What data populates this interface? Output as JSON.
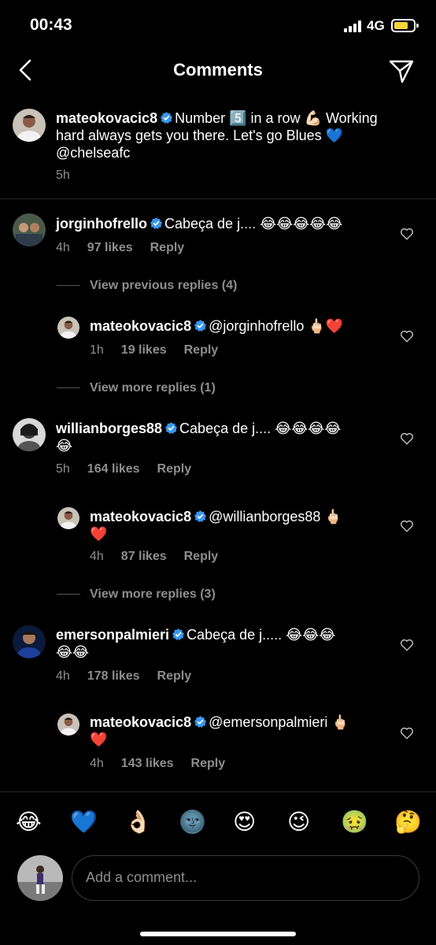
{
  "status_bar": {
    "time": "00:43",
    "network": "4G"
  },
  "header": {
    "title": "Comments"
  },
  "caption": {
    "username": "mateokovacic8",
    "text_line1": "Number 5️⃣ in a row 💪🏻 Working",
    "text_line2": "hard always gets you there. Let's go Blues 💙",
    "text_line3": "@chelseafc",
    "time": "5h"
  },
  "comments": [
    {
      "username": "jorginhofrello",
      "text": "Cabeça de j.... 😂😂😂😂😂",
      "time": "4h",
      "likes": "97 likes",
      "reply": "Reply",
      "view_previous": "View previous replies (4)",
      "reply_item": {
        "username": "mateokovacic8",
        "text": "@jorginhofrello 🖕🏻❤️",
        "time": "1h",
        "likes": "19 likes",
        "reply": "Reply"
      },
      "view_more": "View more replies (1)"
    },
    {
      "username": "willianborges88",
      "text_line1": "Cabeça de j.... 😂😂😂😂",
      "text_line2": "😂",
      "time": "5h",
      "likes": "164 likes",
      "reply": "Reply",
      "reply_item": {
        "username": "mateokovacic8",
        "text_line1": "@willianborges88 🖕🏻",
        "text_line2": "❤️",
        "time": "4h",
        "likes": "87 likes",
        "reply": "Reply"
      },
      "view_more": "View more replies (3)"
    },
    {
      "username": "emersonpalmieri",
      "text_line1": "Cabeça de j..... 😂😂😂",
      "text_line2": "😂😂",
      "time": "4h",
      "likes": "178 likes",
      "reply": "Reply",
      "reply_item": {
        "username": "mateokovacic8",
        "text_line1": "@emersonpalmieri 🖕🏻",
        "text_line2": "❤️",
        "time": "4h",
        "likes": "143 likes",
        "reply": "Reply"
      }
    }
  ],
  "emoji_bar": [
    "😂",
    "💙",
    "👌🏻",
    "🌚",
    "😍",
    "😉",
    "🤢",
    "🤔"
  ],
  "composer": {
    "placeholder": "Add a comment..."
  },
  "colors": {
    "verified": "#3897f0",
    "meta": "#8e8e8e",
    "battery": "#f8d33a"
  },
  "icons": [
    "back-icon",
    "send-icon",
    "heart-icon",
    "verified-icon"
  ]
}
